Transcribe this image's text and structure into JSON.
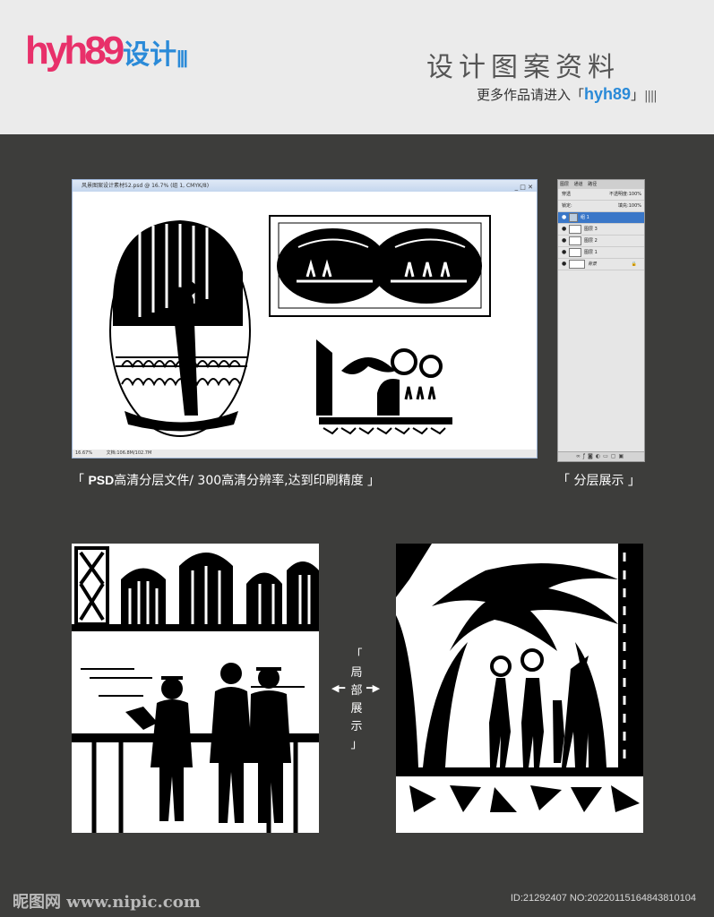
{
  "header": {
    "logo_main": "hyh89",
    "logo_suffix": "设计",
    "logo_dots": "|||",
    "title": "设计图案资料",
    "subtitle_prefix": "更多作品请进入「",
    "subtitle_brand": "hyh89",
    "subtitle_suffix": "」",
    "subtitle_bars": "||||"
  },
  "psd_window": {
    "title": "风景图案设计素材52.psd @ 16.7% (组 1, CMYK/8)",
    "controls": "_ □ ✕",
    "status_zoom": "16.67%",
    "status_doc": "文档:106.8M/102.7M"
  },
  "layers_panel": {
    "tabs": [
      "图层",
      "通道",
      "路径"
    ],
    "blend_mode": "穿透",
    "opacity_label": "不透明度:",
    "opacity_value": "100%",
    "lock_label": "锁定:",
    "fill_label": "填充:",
    "fill_value": "100%",
    "layers": [
      {
        "name": "组 1",
        "selected": true
      },
      {
        "name": "图层 3",
        "selected": false
      },
      {
        "name": "图层 2",
        "selected": false
      },
      {
        "name": "图层 1",
        "selected": false
      },
      {
        "name": "背景",
        "selected": false
      }
    ]
  },
  "captions": {
    "psd_open": "「 ",
    "psd_bold": "PSD",
    "psd_rest": "高清分层文件/ 300高清分辨率,达到印刷精度 」",
    "layers": "「 分层展示 」",
    "detail_open": "「",
    "detail_chars": [
      "局",
      "部",
      "展",
      "示"
    ],
    "detail_close": "」",
    "arrow_left": "◀━",
    "arrow_right": "━▶"
  },
  "footer": {
    "watermark": "昵图网 www.nipic.com",
    "id_text": "ID:21292407 NO:20220115164843810104"
  }
}
